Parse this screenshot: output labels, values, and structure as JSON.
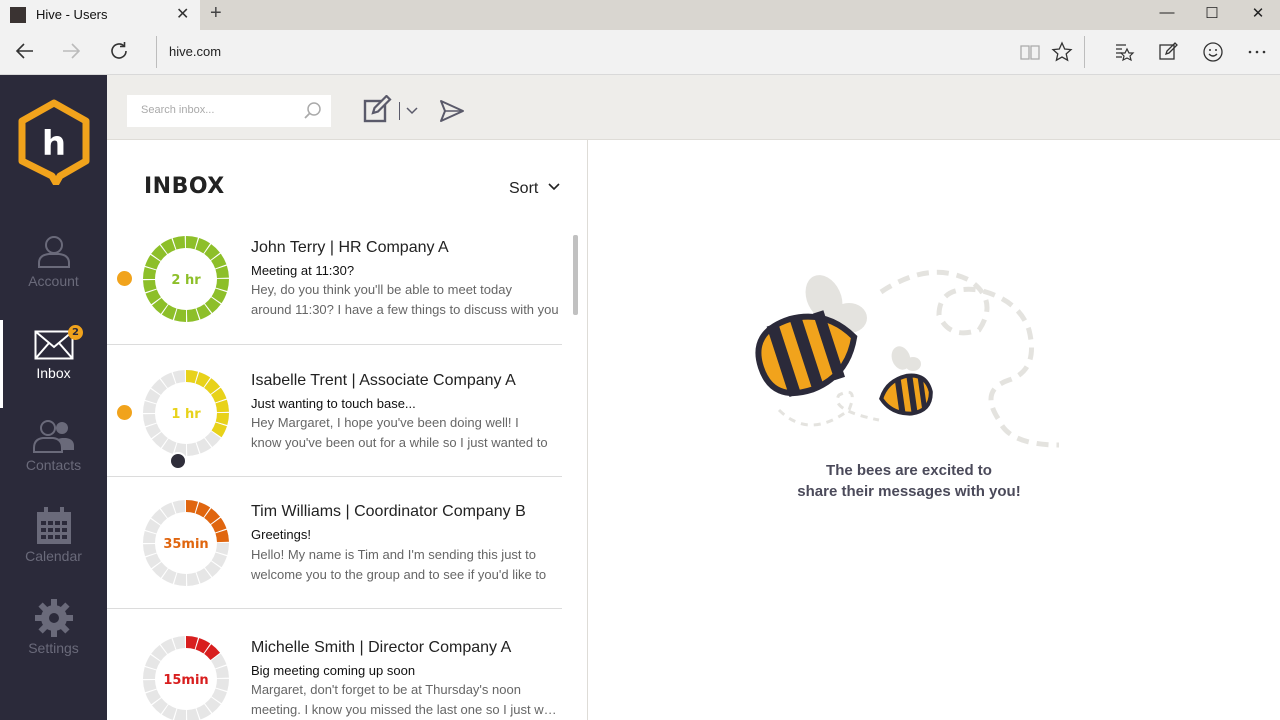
{
  "browser": {
    "tab_title": "Hive - Users",
    "new_tab_glyph": "+",
    "url": "hive.com"
  },
  "sidebar": {
    "logo_letter": "h",
    "items": [
      {
        "label": "Account",
        "icon": "user-icon"
      },
      {
        "label": "Inbox",
        "icon": "envelope-icon",
        "badge": "2",
        "active": true
      },
      {
        "label": "Contacts",
        "icon": "contacts-icon"
      },
      {
        "label": "Calendar",
        "icon": "calendar-icon"
      },
      {
        "label": "Settings",
        "icon": "gear-icon"
      }
    ]
  },
  "toolbar": {
    "search_placeholder": "Search inbox..."
  },
  "inbox": {
    "title": "INBOX",
    "sort_label": "Sort",
    "messages": [
      {
        "from": "John Terry | HR Company A",
        "subject": "Meeting at 11:30?",
        "preview_1": "Hey, do you think you'll be able to meet today",
        "preview_2": "around 11:30? I have a few things to discuss with you",
        "time": "2 hr",
        "color": "#8dbf29",
        "unread": true
      },
      {
        "from": "Isabelle Trent | Associate Company A",
        "subject": "Just wanting to touch base...",
        "preview_1": "Hey Margaret, I hope you've been doing well! I",
        "preview_2": "know you've been out for a while so I just wanted to",
        "time": "1 hr",
        "color": "#e8d21a",
        "unread": true
      },
      {
        "from": "Tim Williams | Coordinator Company B",
        "subject": "Greetings!",
        "preview_1": "Hello! My name is Tim and I'm sending this just to",
        "preview_2": "welcome you to the group and to see if you'd like to",
        "time": "35min",
        "color": "#e0660f",
        "unread": false
      },
      {
        "from": "Michelle Smith | Director Company A",
        "subject": "Big meeting coming up soon",
        "preview_1": "Margaret, don't forget to be at Thursday's noon",
        "preview_2": "meeting. I know you missed the last one so I just wanted",
        "time": "15min",
        "color": "#d81e1e",
        "unread": false
      }
    ]
  },
  "reading_pane": {
    "empty_line_1": "The bees are excited to",
    "empty_line_2": "share their messages with you!"
  },
  "colors": {
    "sidebar_bg": "#2b2a3a",
    "accent": "#f1a31c"
  }
}
